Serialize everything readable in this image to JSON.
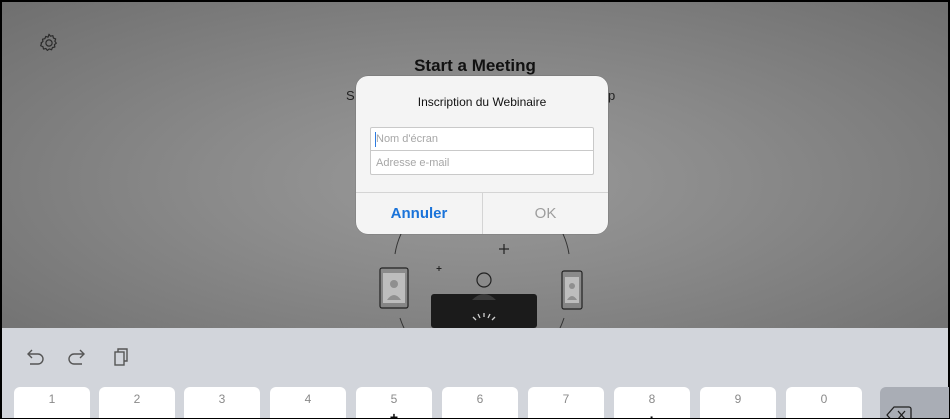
{
  "screen": {
    "icons": {
      "settings": "gear-icon"
    },
    "title": "Start a Meeting",
    "subtitle_left_fragment": "S",
    "subtitle_right_fragment": "p"
  },
  "dialog": {
    "title": "Inscription du Webinaire",
    "name_placeholder": "Nom d'écran",
    "email_placeholder": "Adresse e-mail",
    "cancel_label": "Annuler",
    "ok_label": "OK",
    "colors": {
      "cancel": "#1a73d9",
      "ok_disabled": "#9d9d9d"
    }
  },
  "keyboard": {
    "toolbar_icons": [
      "undo-icon",
      "redo-icon",
      "paste-icon"
    ],
    "keys": [
      {
        "num": "1",
        "sym": ""
      },
      {
        "num": "2",
        "sym": ""
      },
      {
        "num": "3",
        "sym": ""
      },
      {
        "num": "4",
        "sym": ""
      },
      {
        "num": "5",
        "sym": "+"
      },
      {
        "num": "6",
        "sym": ""
      },
      {
        "num": "7",
        "sym": ""
      },
      {
        "num": "8",
        "sym": "·"
      },
      {
        "num": "9",
        "sym": ""
      },
      {
        "num": "0",
        "sym": ""
      }
    ],
    "delete_icon": "backspace-icon"
  }
}
